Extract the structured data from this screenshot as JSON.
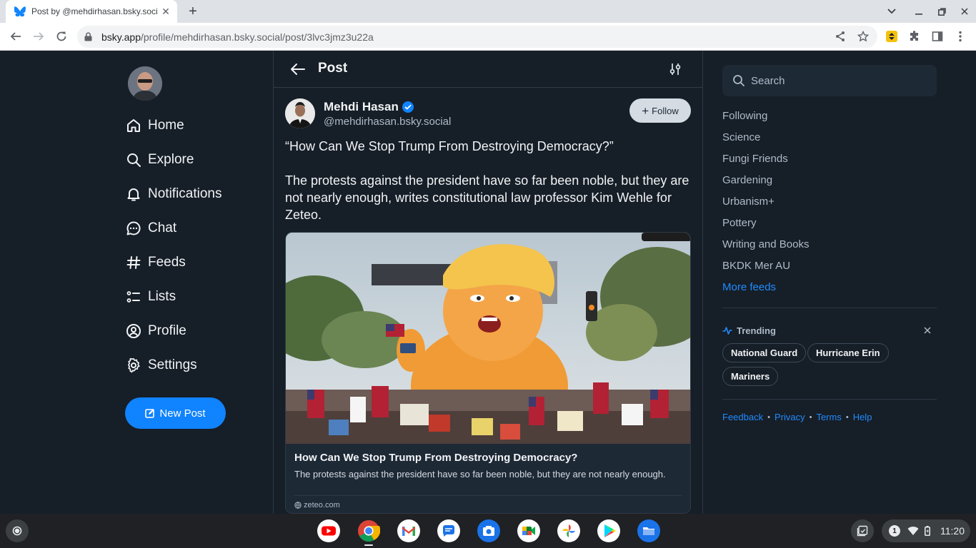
{
  "browser": {
    "tab_title": "Post by @mehdirhasan.bsky.social",
    "url_domain": "bsky.app",
    "url_path": "/profile/mehdirhasan.bsky.social/post/3lvc3jmz3u22a"
  },
  "nav": {
    "items": [
      {
        "label": "Home",
        "icon": "home-icon"
      },
      {
        "label": "Explore",
        "icon": "search-icon"
      },
      {
        "label": "Notifications",
        "icon": "bell-icon"
      },
      {
        "label": "Chat",
        "icon": "chat-icon"
      },
      {
        "label": "Feeds",
        "icon": "hash-icon"
      },
      {
        "label": "Lists",
        "icon": "list-icon"
      },
      {
        "label": "Profile",
        "icon": "profile-icon"
      },
      {
        "label": "Settings",
        "icon": "gear-icon"
      }
    ],
    "new_post_label": "New Post"
  },
  "post": {
    "header_title": "Post",
    "author_name": "Mehdi Hasan",
    "author_handle": "@mehdirhasan.bsky.social",
    "follow_label": "Follow",
    "text_1": "“How Can We Stop Trump From Destroying Democracy?”",
    "text_2": "The protests against the president have so far been noble, but they are not nearly enough, writes constitutional law professor Kim Wehle for Zeteo.",
    "card": {
      "title": "How Can We Stop Trump From Destroying Democracy?",
      "description": "The protests against the president have so far been noble, but they are not nearly enough.",
      "domain": "zeteo.com"
    }
  },
  "sidebar": {
    "search_placeholder": "Search",
    "feeds": [
      "Following",
      "Science",
      "Fungi Friends",
      "Gardening",
      "Urbanism+",
      "Pottery",
      "Writing and Books",
      "BKDK Mer AU"
    ],
    "more_feeds": "More feeds",
    "trending_label": "Trending",
    "trending": [
      "National Guard",
      "Hurricane Erin",
      "Mariners"
    ],
    "footer": [
      "Feedback",
      "Privacy",
      "Terms",
      "Help"
    ]
  },
  "shelf": {
    "notification_count": "1",
    "time": "11:20"
  },
  "colors": {
    "background": "#161e27",
    "accent": "#1083fe",
    "link": "#208bfe"
  }
}
